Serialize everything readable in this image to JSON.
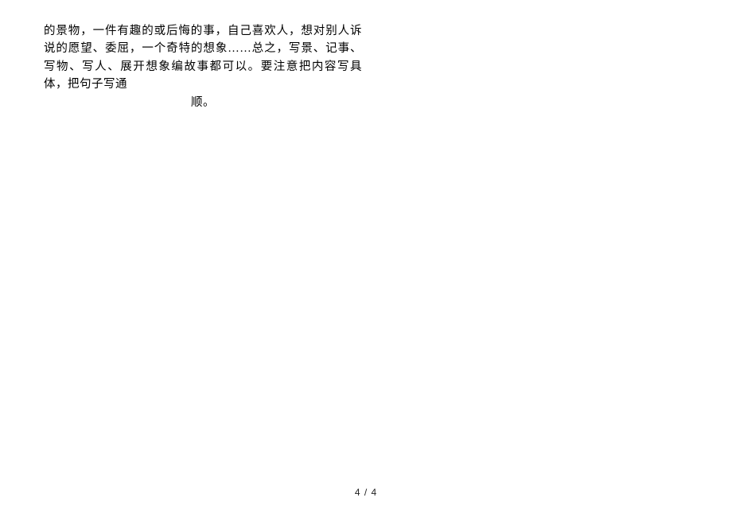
{
  "body": {
    "lines": "的景物，一件有趣的或后悔的事，自己喜欢人，想对别人诉说的愿望、委屈，一个奇特的想象……总之，写景、记事、写物、写人、展开想象编故事都可以。要注意把内容写具体，把句子写通",
    "last_line_centered": "顺。"
  },
  "footer": {
    "page_number": "4 / 4"
  }
}
